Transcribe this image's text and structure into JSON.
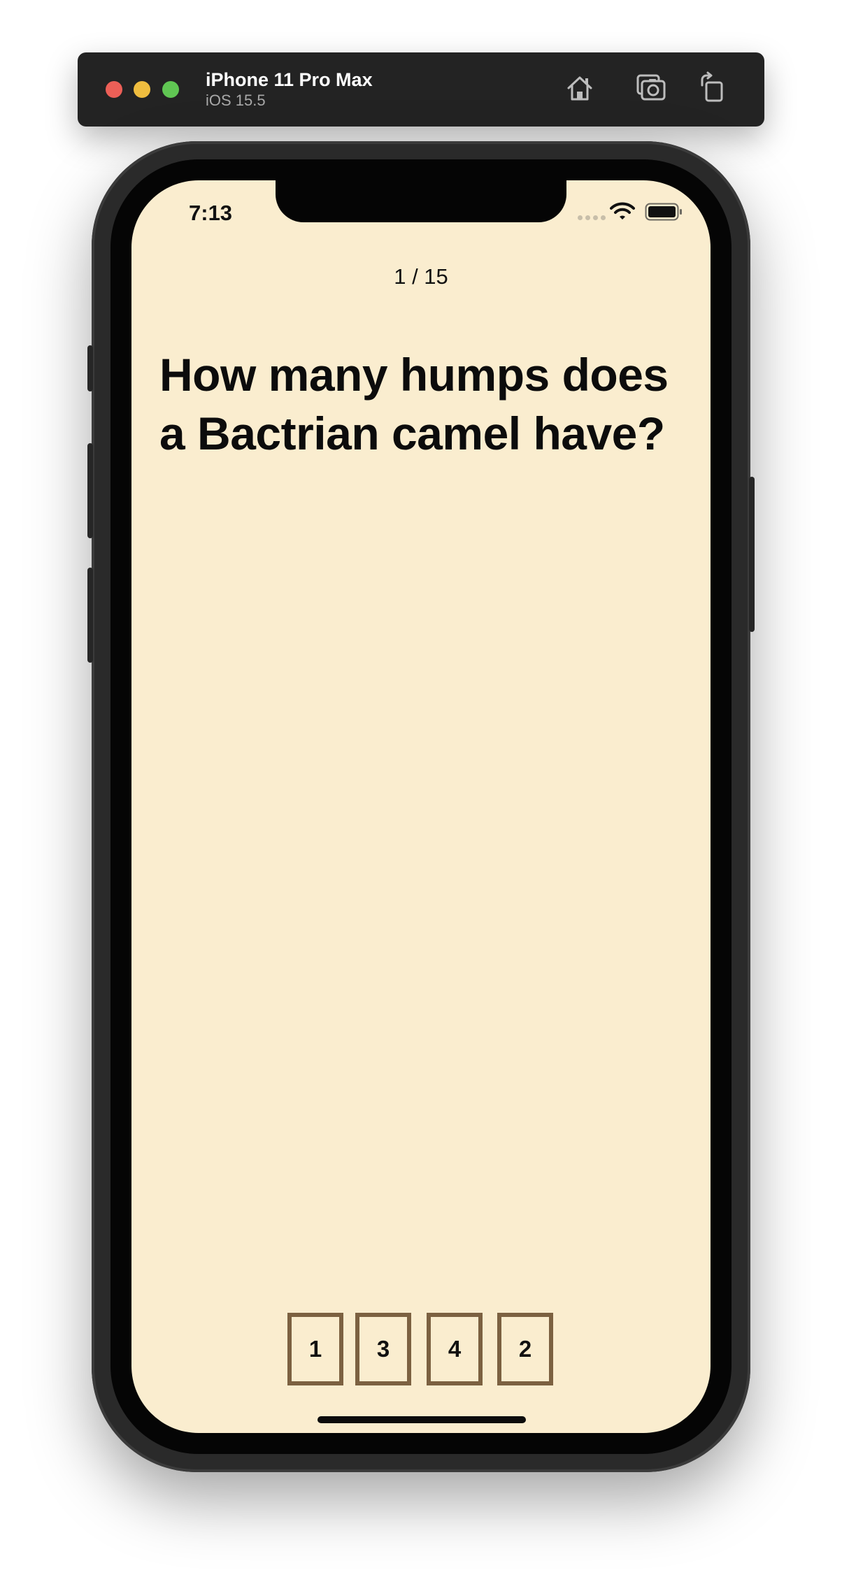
{
  "simulator": {
    "device_name": "iPhone 11 Pro Max",
    "os_version": "iOS 15.5",
    "toolbar_icons": [
      "home-icon",
      "screenshot-icon",
      "rotate-icon"
    ],
    "window_controls": {
      "close": "#ec5f57",
      "minimize": "#efbd3f",
      "zoom": "#60c653"
    }
  },
  "status_bar": {
    "time": "7:13",
    "icons": [
      "cellular-icon",
      "wifi-icon",
      "battery-icon"
    ]
  },
  "quiz": {
    "progress": "1 / 15",
    "question": "How many humps does a Bactrian camel have?",
    "answers": [
      "1",
      "3",
      "4",
      "2"
    ]
  },
  "colors": {
    "background": "#faedcf",
    "answer_border": "#7c6141",
    "text": "#0c0c0c"
  }
}
